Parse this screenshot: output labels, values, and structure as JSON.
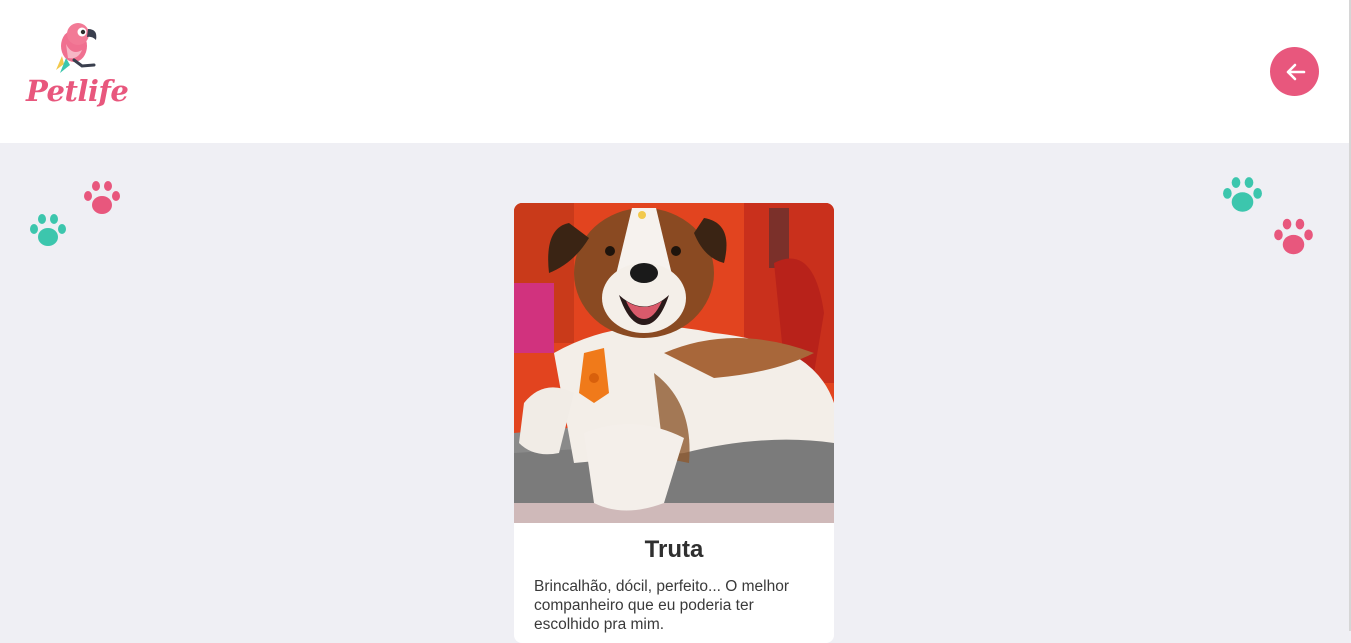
{
  "header": {
    "logo_text": "Petlife",
    "back_icon": "arrow-left-icon"
  },
  "colors": {
    "brand_pink": "#e8577d",
    "paw_teal": "#3cc6ad",
    "background": "#efeff4"
  },
  "decorations": {
    "paw_icon": "paw-print-icon"
  },
  "pet": {
    "name": "Truta",
    "description": "Brincalhão, dócil, perfeito... O melhor companheiro que eu poderia ter escolhido pra mim."
  }
}
